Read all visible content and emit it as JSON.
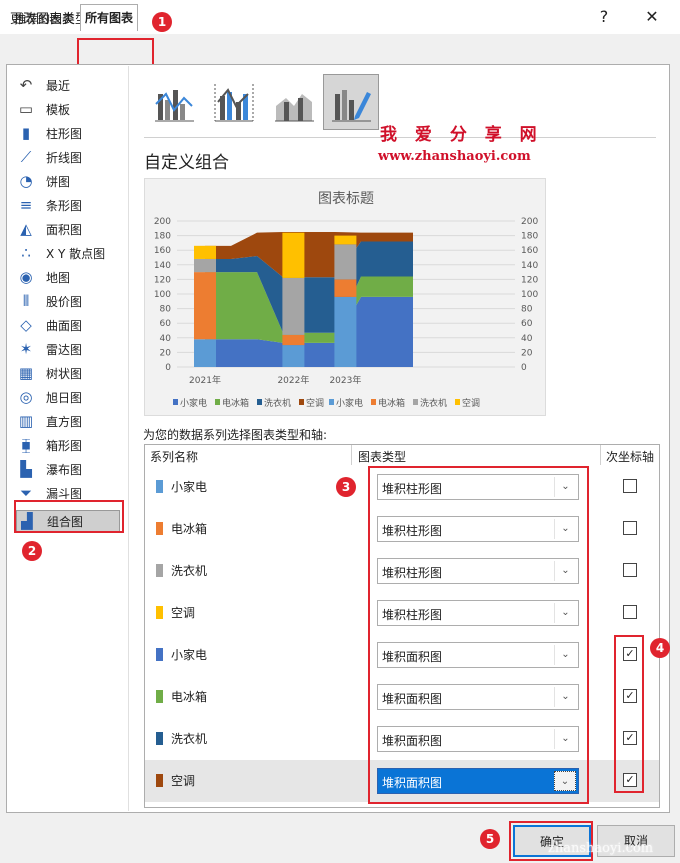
{
  "window": {
    "title": "更改图表类型",
    "help": "?",
    "close": "✕"
  },
  "tabs": [
    {
      "label": "推荐的图表"
    },
    {
      "label": "所有图表"
    }
  ],
  "sidebar": {
    "items": [
      {
        "label": "最近"
      },
      {
        "label": "模板"
      },
      {
        "label": "柱形图"
      },
      {
        "label": "折线图"
      },
      {
        "label": "饼图"
      },
      {
        "label": "条形图"
      },
      {
        "label": "面积图"
      },
      {
        "label": "X Y 散点图"
      },
      {
        "label": "地图"
      },
      {
        "label": "股价图"
      },
      {
        "label": "曲面图"
      },
      {
        "label": "雷达图"
      },
      {
        "label": "树状图"
      },
      {
        "label": "旭日图"
      },
      {
        "label": "直方图"
      },
      {
        "label": "箱形图"
      },
      {
        "label": "瀑布图"
      },
      {
        "label": "漏斗图"
      },
      {
        "label": "组合图"
      }
    ]
  },
  "main": {
    "heading": "自定义组合",
    "instruction": "为您的数据系列选择图表类型和轴:",
    "columns": {
      "series": "系列名称",
      "type": "图表类型",
      "secondary": "次坐标轴"
    }
  },
  "series_rows": [
    {
      "name": "小家电",
      "color": "#5b9bd5",
      "type": "堆积柱形图",
      "secondary": false,
      "mark": ""
    },
    {
      "name": "电冰箱",
      "color": "#ed7d31",
      "type": "堆积柱形图",
      "secondary": false,
      "mark": ""
    },
    {
      "name": "洗衣机",
      "color": "#a5a5a5",
      "type": "堆积柱形图",
      "secondary": false,
      "mark": ""
    },
    {
      "name": "空调",
      "color": "#ffc000",
      "type": "堆积柱形图",
      "secondary": false,
      "mark": ""
    },
    {
      "name": "小家电",
      "color": "#4472c4",
      "type": "堆积面积图",
      "secondary": true,
      "mark": "✓"
    },
    {
      "name": "电冰箱",
      "color": "#70ad47",
      "type": "堆积面积图",
      "secondary": true,
      "mark": "✓"
    },
    {
      "name": "洗衣机",
      "color": "#255e91",
      "type": "堆积面积图",
      "secondary": true,
      "mark": "✓"
    },
    {
      "name": "空调",
      "color": "#9e480e",
      "type": "堆积面积图",
      "secondary": true,
      "mark": "✓"
    }
  ],
  "buttons": {
    "ok": "确定",
    "cancel": "取消"
  },
  "watermark": {
    "line1": "我 爱 分 享 网",
    "line2": "www.zhanshaoyi.com",
    "line3": "zhanshaoyi.com"
  },
  "badges": [
    "1",
    "2",
    "3",
    "4",
    "5"
  ],
  "chart_data": {
    "type": "bar",
    "title": "图表标题",
    "x_tick_labels": [
      "2021年",
      "2022年",
      "2023年"
    ],
    "y_ticks": [
      "200",
      "180",
      "160",
      "140",
      "120",
      "100",
      "80",
      "60",
      "40",
      "20",
      "0"
    ],
    "y2_ticks": [
      "200",
      "180",
      "160",
      "140",
      "120",
      "100",
      "80",
      "60",
      "40",
      "20",
      "0"
    ],
    "ylim": [
      0,
      200
    ],
    "y2lim": [
      0,
      200
    ],
    "categories": [
      "2021年",
      "2022年",
      "2023年"
    ],
    "columns": [
      {
        "name": "小家电",
        "color": "#5b9bd5",
        "values": [
          38,
          30,
          96
        ]
      },
      {
        "name": "电冰箱",
        "color": "#ed7d31",
        "values": [
          92,
          14,
          24
        ]
      },
      {
        "name": "洗衣机",
        "color": "#a5a5a5",
        "values": [
          18,
          78,
          48
        ]
      },
      {
        "name": "空调",
        "color": "#ffc000",
        "values": [
          18,
          62,
          12
        ]
      }
    ],
    "area_x": [
      0,
      0.5,
      1,
      1.5,
      2,
      2.5,
      3,
      3.5,
      4
    ],
    "areas": [
      {
        "name": "小家电",
        "color": "#4472c4",
        "values": [
          38,
          38,
          38,
          33,
          33,
          33,
          96,
          96,
          96
        ]
      },
      {
        "name": "电冰箱",
        "color": "#70ad47",
        "values": [
          92,
          92,
          92,
          14,
          14,
          14,
          28,
          28,
          28
        ]
      },
      {
        "name": "洗衣机",
        "color": "#255e91",
        "values": [
          18,
          18,
          22,
          76,
          76,
          76,
          48,
          48,
          48
        ]
      },
      {
        "name": "空调",
        "color": "#9e480e",
        "values": [
          18,
          18,
          32,
          62,
          62,
          62,
          12,
          12,
          12
        ]
      }
    ],
    "legend": [
      "小家电",
      "电冰箱",
      "洗衣机",
      "空调",
      "小家电",
      "电冰箱",
      "洗衣机",
      "空调"
    ],
    "legend_colors": [
      "#4472c4",
      "#70ad47",
      "#255e91",
      "#9e480e",
      "#5b9bd5",
      "#ed7d31",
      "#a5a5a5",
      "#ffc000"
    ],
    "legend_position": "bottom",
    "grid": true
  }
}
